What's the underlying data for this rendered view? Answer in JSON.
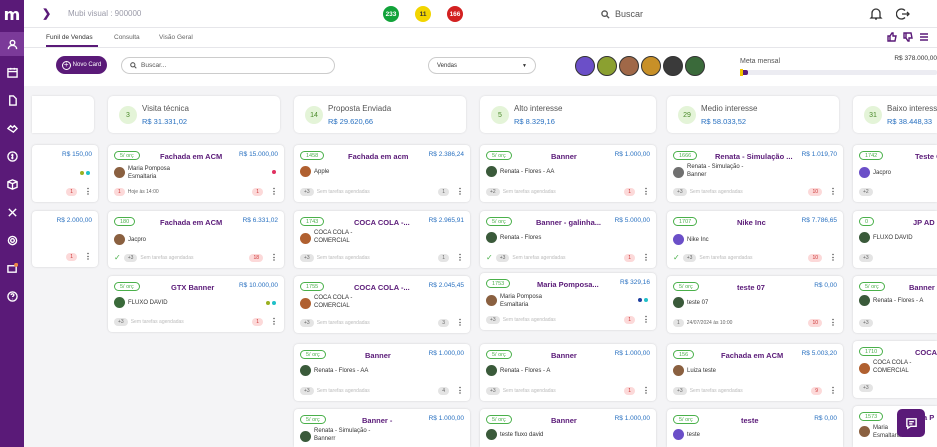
{
  "app": {
    "logo": "m",
    "version": "Mubi visual : 900000"
  },
  "badges": [
    "233",
    "11",
    "166"
  ],
  "header_search": "Buscar",
  "tabs": [
    {
      "label": "Funil de Vendas"
    },
    {
      "label": "Consulta"
    },
    {
      "label": "Visão Geral"
    }
  ],
  "toolbar": {
    "new_card": "Novo Card",
    "search_placeholder": "Buscar...",
    "pipeline": "Vendas"
  },
  "meta": {
    "label": "Meta mensal",
    "value": "R$ 378.000,00",
    "progress_percent": 4
  },
  "stages": [
    {
      "count": "3",
      "name": "Visita técnica",
      "value": "R$ 31.331,02"
    },
    {
      "count": "14",
      "name": "Proposta Enviada",
      "value": "R$ 29.620,66"
    },
    {
      "count": "5",
      "name": "Alto interesse",
      "value": "R$ 8.329,16"
    },
    {
      "count": "29",
      "name": "Medio interesse",
      "value": "R$ 58.033,52"
    },
    {
      "count": "31",
      "name": "Baixo interesse",
      "value": "R$ 38.448,33"
    }
  ],
  "col0": [
    {
      "value": "R$ 150,00",
      "count": "1"
    },
    {
      "value": "R$ 2.000,00",
      "count": "1"
    }
  ],
  "col1": [
    {
      "tag": "5/ orç",
      "title": "Fachada em ACM",
      "value": "R$ 15.000,00",
      "name": "Maria Pomposa Esmaltaria",
      "count": "1",
      "date": "Hoje às 14:00"
    },
    {
      "tag": "180",
      "title": "Fachada em ACM",
      "value": "R$ 6.331,02",
      "name": "Jacpro",
      "tasks": "+3",
      "foot": "Sem tarefas agendadas",
      "count": "18"
    },
    {
      "tag": "5/ orç",
      "title": "GTX Banner",
      "value": "R$ 10.000,00",
      "name": "FLUXO DAVID",
      "tasks": "+3",
      "foot": "Sem tarefas agendadas",
      "count": "1"
    }
  ],
  "col2": [
    {
      "tag": "1458",
      "title": "Fachada em acm",
      "value": "R$ 2.386,24",
      "name": "Apple",
      "tasks": "+3",
      "foot": "Sem tarefas agendadas",
      "count": "1"
    },
    {
      "tag": "1743",
      "title": "COCA COLA -...",
      "value": "R$ 2.965,91",
      "name": "COCA COLA - COMERCIAL",
      "tasks": "+3",
      "foot": "Sem tarefas agendadas",
      "count": "1"
    },
    {
      "tag": "1755",
      "title": "COCA COLA -...",
      "value": "R$ 2.045,45",
      "name": "COCA COLA - COMERCIAL",
      "tasks": "+3",
      "foot": "Sem tarefas agendadas",
      "count": "3"
    },
    {
      "tag": "5/ orç",
      "title": "Banner",
      "value": "R$ 1.000,00",
      "name": "Renata - Flores - AA",
      "tasks": "+3",
      "foot": "Sem tarefas agendadas",
      "count": "4"
    },
    {
      "tag": "5/ orç",
      "title": "Banner -",
      "value": "R$ 1.000,00",
      "name": "Renata - Simulação - Bannerr"
    }
  ],
  "col3": [
    {
      "tag": "5/ orç",
      "title": "Banner",
      "value": "R$ 1.000,00",
      "name": "Renata - Flores - AA",
      "tasks": "+2",
      "foot": "Sem tarefas agendadas",
      "count": "1"
    },
    {
      "tag": "5/ orç",
      "title": "Banner - galinha...",
      "value": "R$ 5.000,00",
      "name": "Renata - Flores",
      "tasks": "+3",
      "foot": "Sem tarefas agendadas",
      "count": "1"
    },
    {
      "tag": "1753",
      "title": "Maria Pomposa...",
      "value": "R$ 329,16",
      "name": "Maria Pomposa Esmaltaria",
      "tasks": "+3",
      "foot": "Sem tarefas agendadas",
      "count": "1"
    },
    {
      "tag": "5/ orç",
      "title": "Banner",
      "value": "R$ 1.000,00",
      "name": "Renata - Flores - A",
      "tasks": "+3",
      "foot": "Sem tarefas agendadas",
      "count": "1"
    },
    {
      "tag": "5/ orç",
      "title": "Banner",
      "value": "R$ 1.000,00",
      "name": "teste fluxo david"
    }
  ],
  "col4": [
    {
      "tag": "1666",
      "title": "Renata - Simulação ...",
      "value": "R$ 1.019,70",
      "name": "Renata - Simulação - Banner",
      "tasks": "+3",
      "foot": "Sem tarefas agendadas",
      "count": "10"
    },
    {
      "tag": "1707",
      "title": "Nike Inc",
      "value": "R$ 7.786,65",
      "name": "Nike Inc",
      "tasks": "+3",
      "foot": "Sem tarefas agendadas",
      "count": "10"
    },
    {
      "tag": "5/ orç",
      "title": "teste 07",
      "value": "R$ 0,00",
      "name": "teste 07",
      "tasks": "1",
      "foot": "24/07/2024 às 10:00",
      "count": "10"
    },
    {
      "tag": "156",
      "title": "Fachada em ACM",
      "value": "R$ 5.003,20",
      "name": "Luiza teste",
      "tasks": "+3",
      "foot": "Sem tarefas agendadas",
      "count": "9"
    },
    {
      "tag": "5/ orç",
      "title": "teste",
      "value": "R$ 0,00",
      "name": "teste"
    }
  ],
  "col5": [
    {
      "tag": "1742",
      "title": "Teste C",
      "name": "Jacpro",
      "tasks": "+2"
    },
    {
      "tag": "0",
      "title": "JP AD",
      "name": "FLUXO DAVID",
      "tasks": "+3"
    },
    {
      "tag": "5/ orç",
      "title": "Banner",
      "name": "Renata - Flores - A",
      "tasks": "+3"
    },
    {
      "tag": "1710",
      "title": "COCA",
      "name": "COCA COLA - COMERCIAL",
      "tasks": "+3"
    },
    {
      "tag": "1573",
      "title": "a P",
      "name": "Maria Esmaltaria"
    }
  ]
}
